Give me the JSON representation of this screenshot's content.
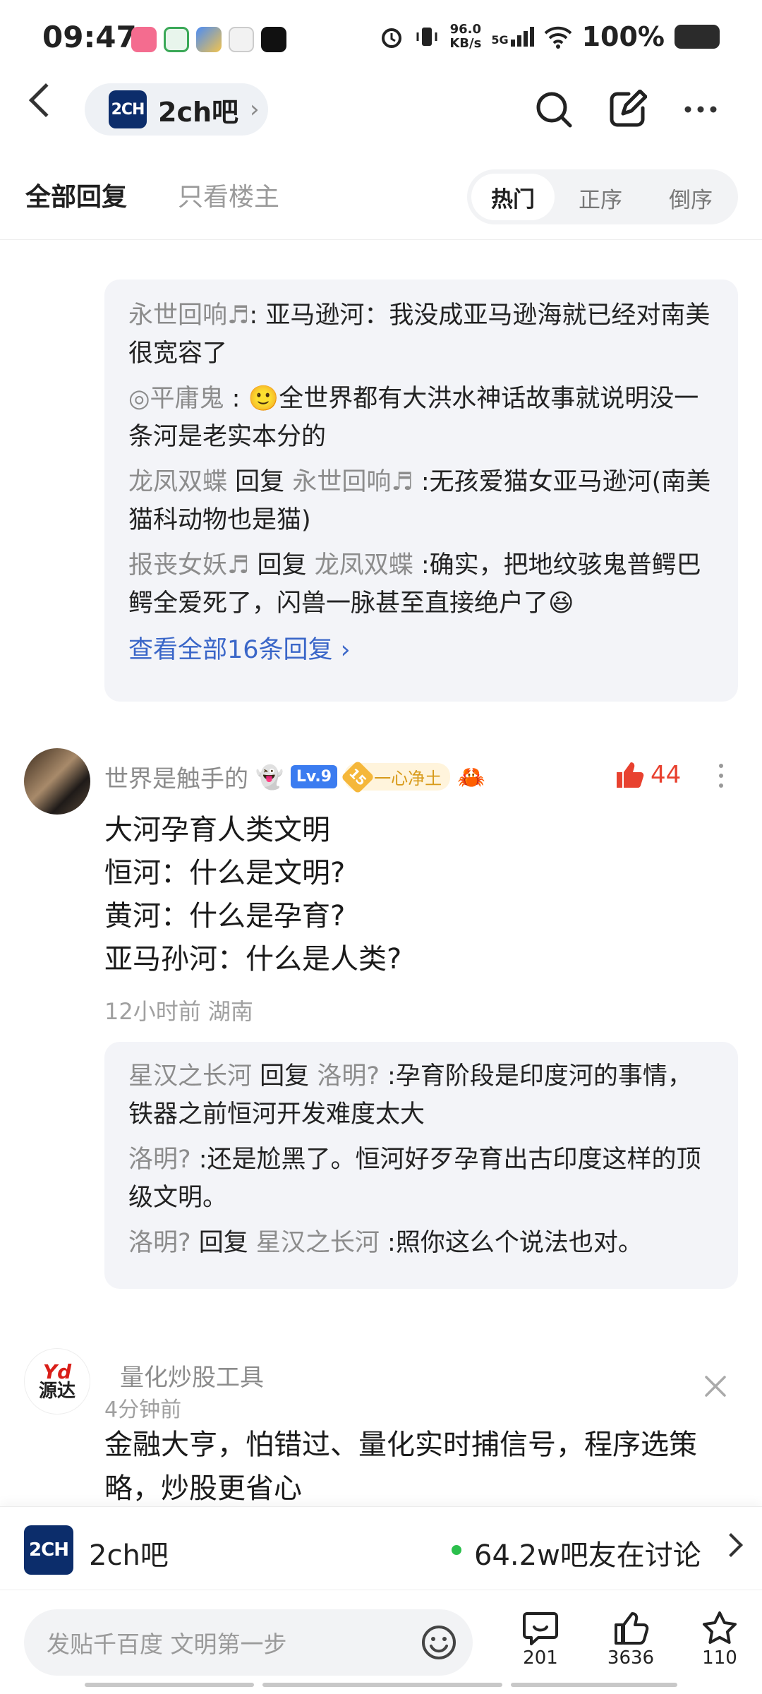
{
  "status_bar": {
    "time": "09:47",
    "speed_top": "96.0",
    "speed_bottom": "KB/s",
    "network": "5G",
    "battery": "100%"
  },
  "header": {
    "logo_text": "2CH",
    "forum_name": "2ch吧",
    "chevron": "›"
  },
  "tabs": {
    "all": "全部回复",
    "owner_only": "只看楼主",
    "sort_hot": "热门",
    "sort_asc": "正序",
    "sort_desc": "倒序"
  },
  "reply_block_1": {
    "lines": [
      {
        "user": "永世回响♬",
        "text": "亚马逊河：我没成亚马逊海就已经对南美很宽容了"
      },
      {
        "user": "◎平庸鬼",
        "emoji": "🙂",
        "text": "全世界都有大洪水神话故事就说明没一条河是老实本分的"
      },
      {
        "user": "龙凤双蝶",
        "reply_word": "回复",
        "target": "永世回响♬",
        "text": ":无孩爱猫女亚马逊河(南美猫科动物也是猫)"
      },
      {
        "user": "报丧女妖♬",
        "reply_word": "回复",
        "target": "龙凤双蝶",
        "text": ":确实，把地纹骇鬼普鳄巴鳄全爱死了，闪兽一脉甚至直接绝户了",
        "emoji": "😆"
      }
    ],
    "view_all": "查看全部16条回复 ›"
  },
  "post": {
    "author": "世界是触手的",
    "level": "Lv.9",
    "fan_level": "15",
    "fan_title": "一心净土",
    "likes": "44",
    "content": [
      "大河孕育人类文明",
      "恒河：什么是文明?",
      "黄河：什么是孕育?",
      "亚马孙河：什么是人类?"
    ],
    "time_location": "12小时前 湖南"
  },
  "reply_block_2": {
    "lines": [
      {
        "user": "星汉之长河",
        "reply_word": "回复",
        "target": "洛明?",
        "text": ":孕育阶段是印度河的事情，铁器之前恒河开发难度太大"
      },
      {
        "user": "洛明?",
        "text": ":还是尬黑了。恒河好歹孕育出古印度这样的顶级文明。"
      },
      {
        "user": "洛明?",
        "reply_word": "回复",
        "target": "星汉之长河",
        "text": ":照你这么个说法也对。"
      }
    ]
  },
  "ad": {
    "logo_top": "Yd",
    "logo_bottom": "源达",
    "name": "量化炒股工具",
    "time": "4分钟前",
    "text": "金融大亨，怕错过、量化实时捕信号，程序选策略，炒股更省心"
  },
  "forum_bar": {
    "logo_text": "2CH",
    "name": "2ch吧",
    "discussing": "64.2w吧友在讨论"
  },
  "input_bar": {
    "placeholder": "发贴千百度 文明第一步",
    "comments": "201",
    "likes": "3636",
    "stars": "110"
  },
  "colors": {
    "accent": "#3a66c8",
    "like": "#e8412f",
    "online": "#2bbf4c"
  }
}
